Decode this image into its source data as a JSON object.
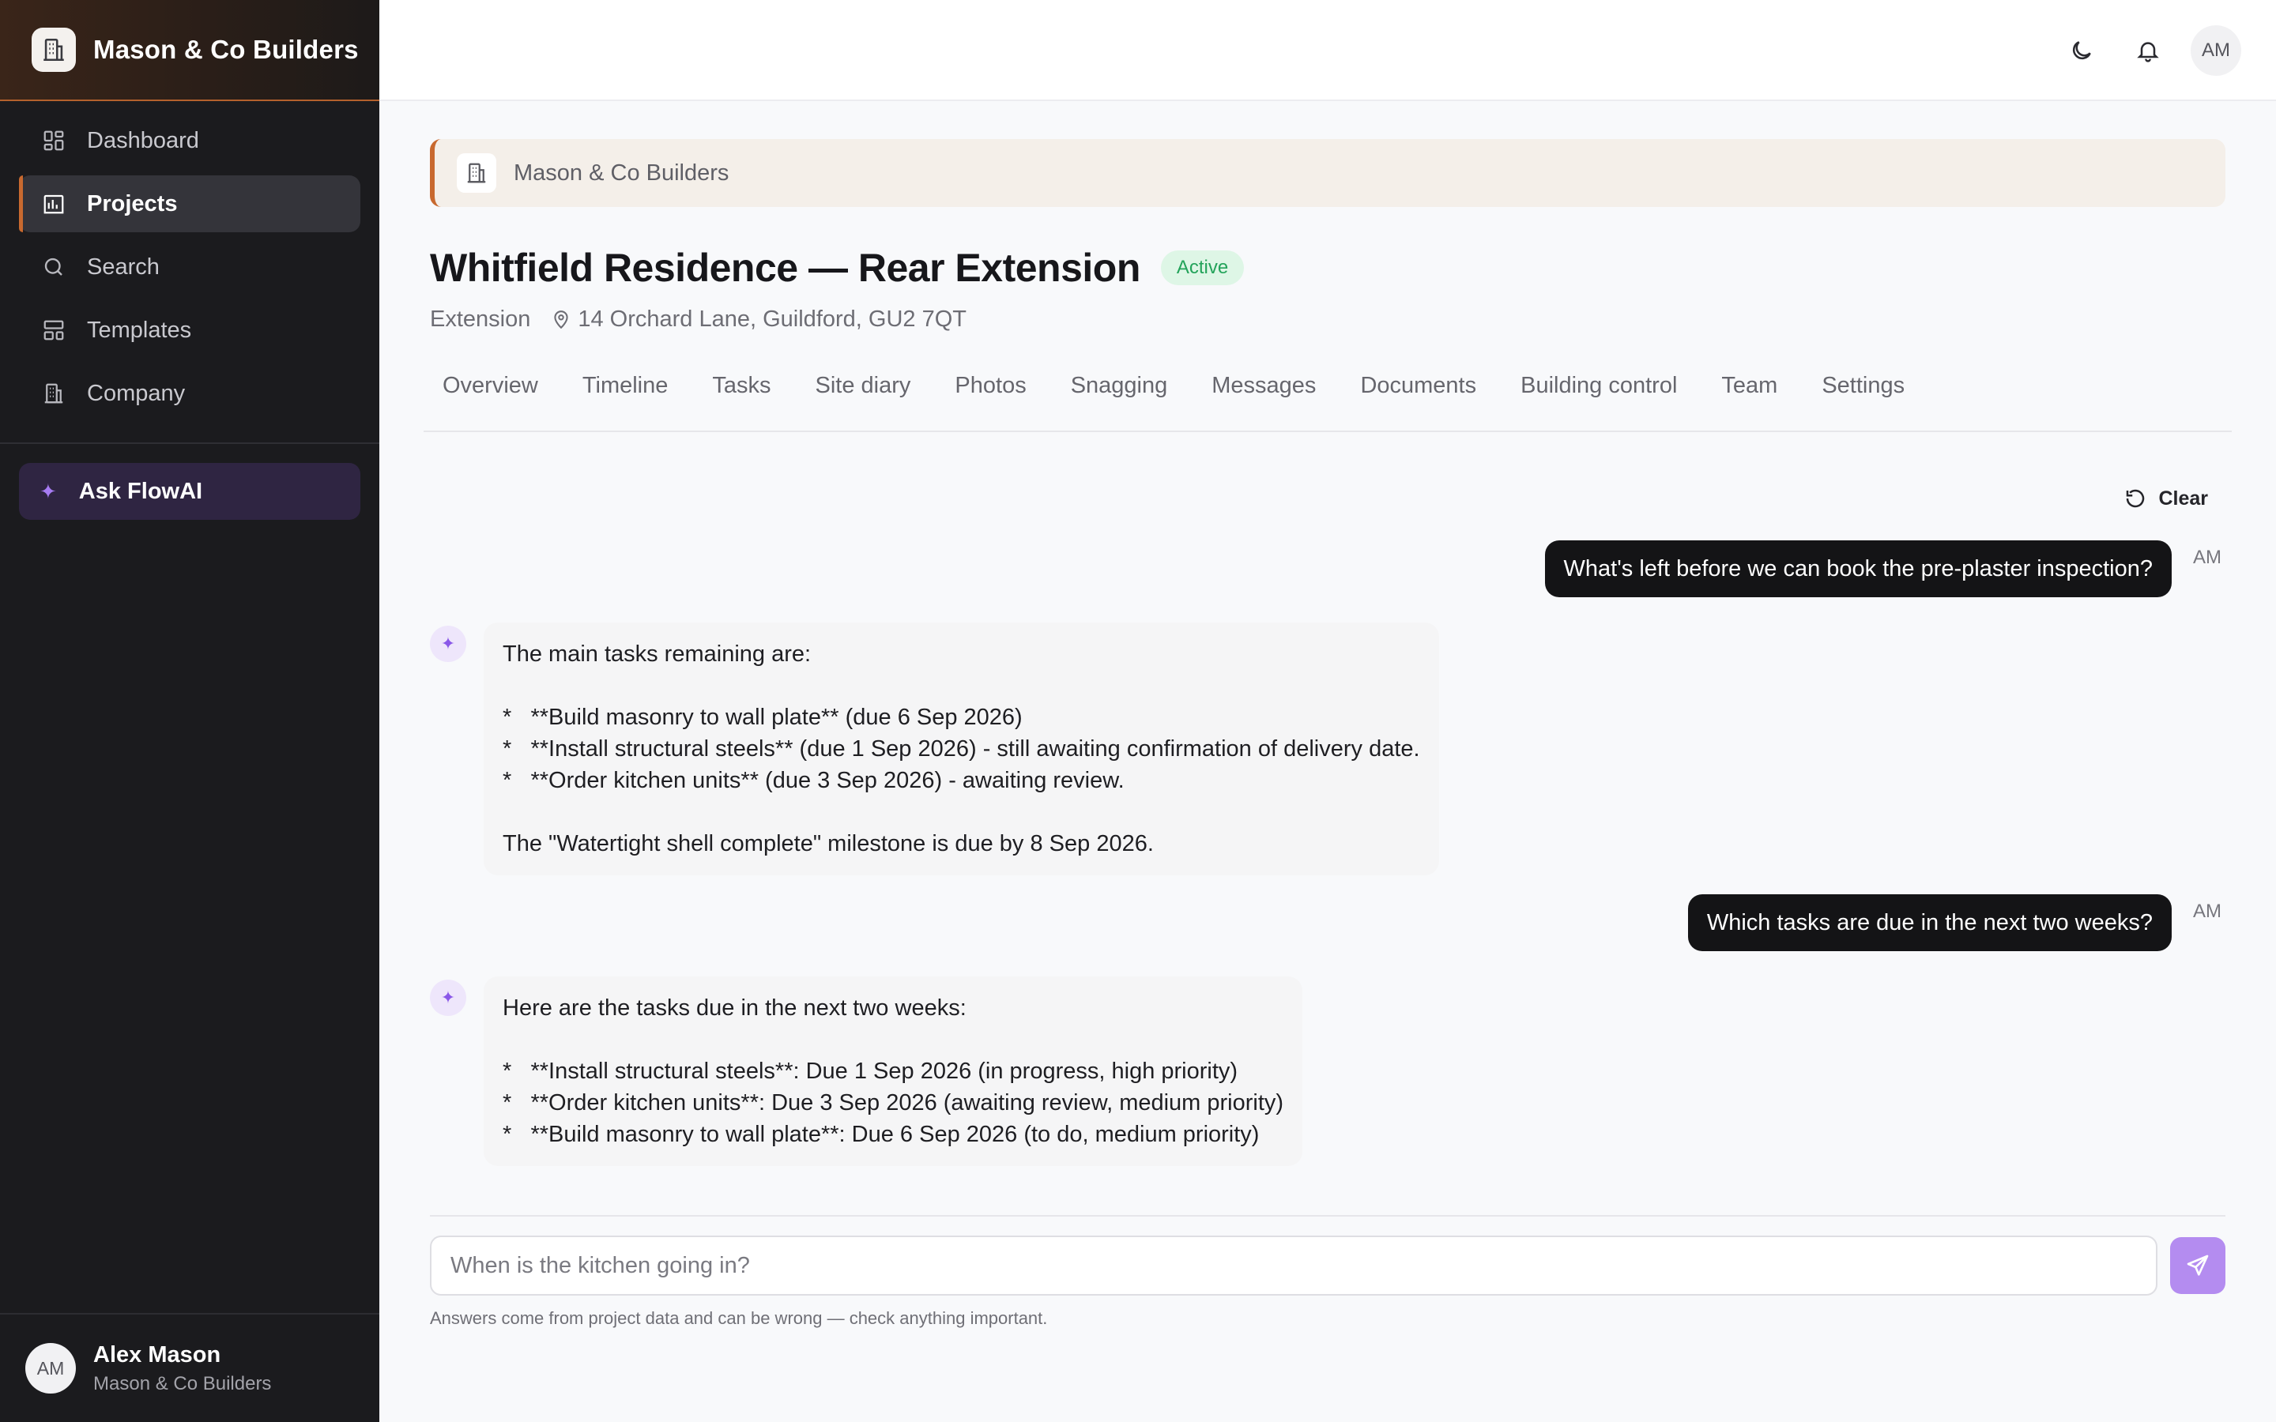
{
  "sidebar": {
    "brand": "Mason & Co Builders",
    "items": [
      {
        "label": "Dashboard",
        "icon": "dashboard-icon"
      },
      {
        "label": "Projects",
        "icon": "projects-icon",
        "active": true
      },
      {
        "label": "Search",
        "icon": "search-icon"
      },
      {
        "label": "Templates",
        "icon": "templates-icon"
      },
      {
        "label": "Company",
        "icon": "company-icon"
      }
    ],
    "ask_label": "Ask FlowAI",
    "user": {
      "initials": "AM",
      "name": "Alex Mason",
      "org": "Mason & Co Builders"
    }
  },
  "topbar": {
    "avatar_initials": "AM",
    "icons": [
      "moon-icon",
      "bell-icon"
    ]
  },
  "project": {
    "company": "Mason & Co Builders",
    "title": "Whitfield Residence — Rear Extension",
    "status": "Active",
    "type": "Extension",
    "address": "14 Orchard Lane, Guildford, GU2 7QT"
  },
  "tabs": [
    "Overview",
    "Timeline",
    "Tasks",
    "Site diary",
    "Photos",
    "Snagging",
    "Messages",
    "Documents",
    "Building control",
    "Team",
    "Settings"
  ],
  "chat": {
    "clear_label": "Clear",
    "user_tag": "AM",
    "messages": [
      {
        "role": "user",
        "text": "What's left before we can book the pre-plaster inspection?"
      },
      {
        "role": "assistant",
        "text": "The main tasks remaining are:\n\n*   **Build masonry to wall plate** (due 6 Sep 2026)\n*   **Install structural steels** (due 1 Sep 2026) - still awaiting confirmation of delivery date.\n*   **Order kitchen units** (due 3 Sep 2026) - awaiting review.\n\nThe \"Watertight shell complete\" milestone is due by 8 Sep 2026."
      },
      {
        "role": "user",
        "text": "Which tasks are due in the next two weeks?"
      },
      {
        "role": "assistant",
        "text": "Here are the tasks due in the next two weeks:\n\n*   **Install structural steels**: Due 1 Sep 2026 (in progress, high priority)\n*   **Order kitchen units**: Due 3 Sep 2026 (awaiting review, medium priority)\n*   **Build masonry to wall plate**: Due 6 Sep 2026 (to do, medium priority)"
      }
    ],
    "input_placeholder": "When is the kitchen going in?",
    "disclaimer": "Answers come from project data and can be wrong — check anything important."
  },
  "colors": {
    "accent": "#c8692f",
    "ai_purple": "#8a58e8",
    "send": "#b48cf0",
    "status_green": "#23a35a"
  }
}
